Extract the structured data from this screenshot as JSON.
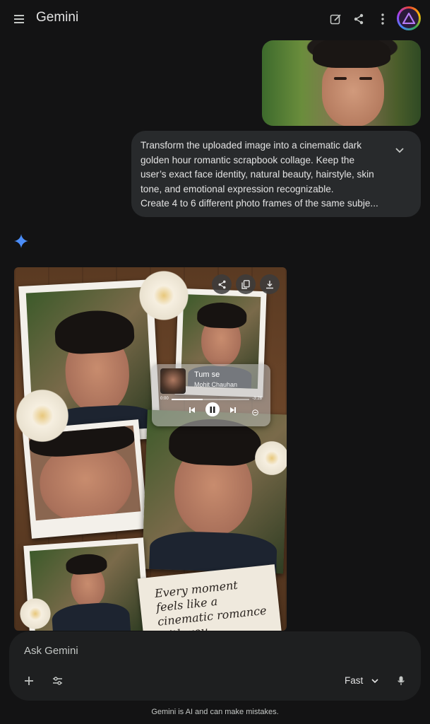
{
  "header": {
    "title": "Gemini",
    "menu_icon": "menu-icon",
    "edit_icon": "edit-icon",
    "share_icon": "share-icon",
    "more_icon": "more-vert-icon",
    "avatar_icon": "avatar-icon"
  },
  "prompt": {
    "lines": [
      "Transform the uploaded image into a cinematic dark",
      "golden hour romantic scrapbook collage. Keep the",
      "user’s exact face identity, natural beauty, hairstyle, skin",
      "tone, and emotional expression recognizable.",
      "Create 4 to 6 different photo frames of the same subje..."
    ],
    "expand_icon": "chevron-down-icon"
  },
  "response": {
    "spark_icon": "gemini-spark-icon",
    "collage": {
      "music_player": {
        "song": "Tum se",
        "artist": "Mohit Chauhan",
        "elapsed": "0:00",
        "remaining": "-3:28",
        "progress": 0.4
      },
      "note_text": "Every moment feels like a cinematic romance with you."
    },
    "actions": [
      "share-icon",
      "copy-icon",
      "download-icon"
    ]
  },
  "input": {
    "placeholder": "Ask Gemini",
    "mode": "Fast",
    "add_icon": "plus-icon",
    "tools_icon": "tune-icon",
    "mic_icon": "mic-icon"
  },
  "footer": {
    "disclaimer": "Gemini is AI and can make mistakes."
  },
  "colors": {
    "background": "#131314",
    "bubble": "#282a2c",
    "input": "#1e1f20",
    "spark": "#4b8df8"
  }
}
